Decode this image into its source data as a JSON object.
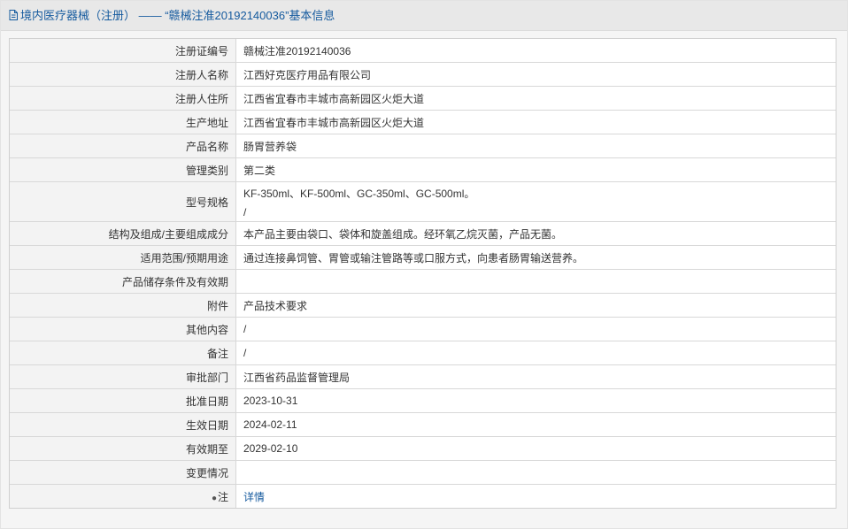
{
  "header": {
    "title": "境内医疗器械（注册） —— “赣械注准20192140036”基本信息"
  },
  "rows": [
    {
      "label": "注册证编号",
      "value": "赣械注准20192140036"
    },
    {
      "label": "注册人名称",
      "value": "江西好克医疗用品有限公司"
    },
    {
      "label": "注册人住所",
      "value": "江西省宜春市丰城市高新园区火炬大道"
    },
    {
      "label": "生产地址",
      "value": "江西省宜春市丰城市高新园区火炬大道"
    },
    {
      "label": "产品名称",
      "value": "肠胃营养袋"
    },
    {
      "label": "管理类别",
      "value": "第二类"
    },
    {
      "label": "型号规格",
      "value": "KF-350ml、KF-500ml、GC-350ml、GC-500ml。",
      "value2": "/"
    },
    {
      "label": "结构及组成/主要组成成分",
      "value": "本产品主要由袋口、袋体和旋盖组成。经环氧乙烷灭菌，产品无菌。"
    },
    {
      "label": "适用范围/预期用途",
      "value": "通过连接鼻饲管、胃管或输注管路等或口服方式，向患者肠胃输送营养。"
    },
    {
      "label": "产品储存条件及有效期",
      "value": ""
    },
    {
      "label": "附件",
      "value": "产品技术要求"
    },
    {
      "label": "其他内容",
      "value": "/"
    },
    {
      "label": "备注",
      "value": "/"
    },
    {
      "label": "审批部门",
      "value": "江西省药品监督管理局"
    },
    {
      "label": "批准日期",
      "value": "2023-10-31"
    },
    {
      "label": "生效日期",
      "value": "2024-02-11"
    },
    {
      "label": "有效期至",
      "value": "2029-02-10"
    },
    {
      "label": "变更情况",
      "value": ""
    },
    {
      "label": "注",
      "value": "详情",
      "icon": "note-icon"
    }
  ]
}
